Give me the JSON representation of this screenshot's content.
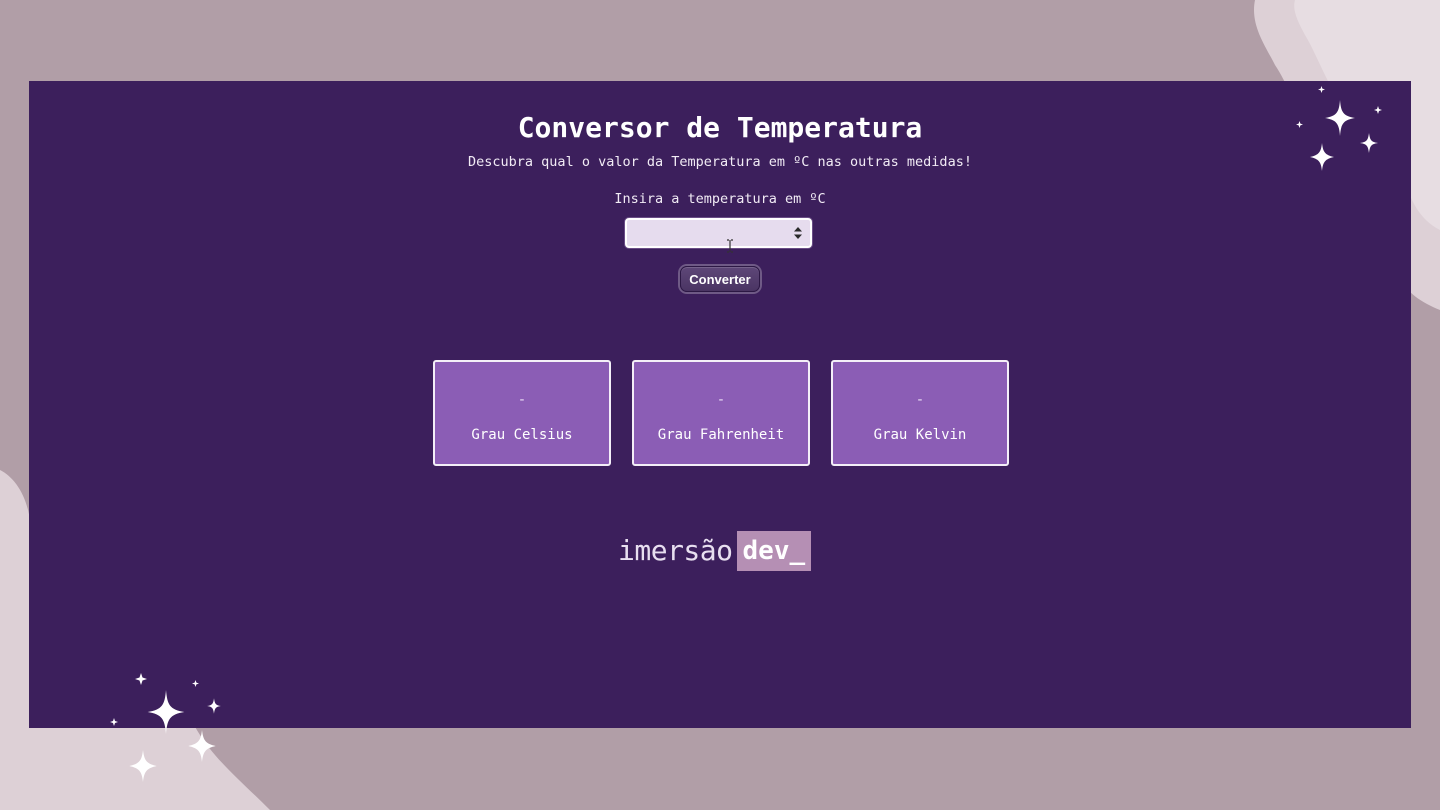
{
  "header": {
    "title": "Conversor de Temperatura",
    "subtitle": "Descubra qual o valor da Temperatura em ºC nas outras medidas!"
  },
  "form": {
    "label": "Insira a temperatura em ºC",
    "input_value": "",
    "button_label": "Converter"
  },
  "results": [
    {
      "value": "-",
      "unit": "Grau Celsius"
    },
    {
      "value": "-",
      "unit": "Grau Fahrenheit"
    },
    {
      "value": "-",
      "unit": "Grau Kelvin"
    }
  ],
  "logo": {
    "text": "imersão",
    "badge": "dev_"
  },
  "colors": {
    "page_background": "#b19ea7",
    "panel_background": "#3c1f5c",
    "card_background": "#8b5db5",
    "logo_badge": "#b58fb4"
  },
  "icons": [
    "sparkle-icon",
    "spinner-icon",
    "text-cursor-icon"
  ]
}
